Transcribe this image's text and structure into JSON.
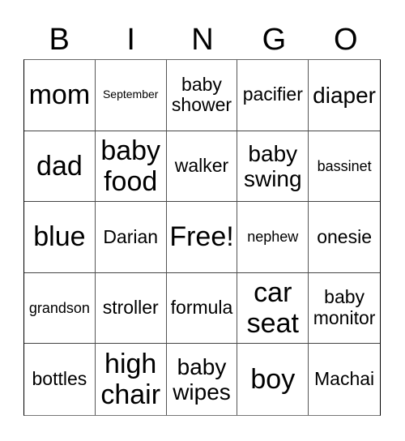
{
  "header": {
    "letters": [
      "B",
      "I",
      "N",
      "G",
      "O"
    ]
  },
  "card": {
    "rows": [
      [
        {
          "text": "mom",
          "size": "xl"
        },
        {
          "text": "September",
          "size": "xs"
        },
        {
          "text": "baby shower",
          "size": "md"
        },
        {
          "text": "pacifier",
          "size": "md"
        },
        {
          "text": "diaper",
          "size": "lg"
        }
      ],
      [
        {
          "text": "dad",
          "size": "xl"
        },
        {
          "text": "baby food",
          "size": "xl"
        },
        {
          "text": "walker",
          "size": "md"
        },
        {
          "text": "baby swing",
          "size": "lg"
        },
        {
          "text": "bassinet",
          "size": "sm"
        }
      ],
      [
        {
          "text": "blue",
          "size": "xl"
        },
        {
          "text": "Darian",
          "size": "md"
        },
        {
          "text": "Free!",
          "size": "xl"
        },
        {
          "text": "nephew",
          "size": "sm"
        },
        {
          "text": "onesie",
          "size": "md"
        }
      ],
      [
        {
          "text": "grandson",
          "size": "sm"
        },
        {
          "text": "stroller",
          "size": "md"
        },
        {
          "text": "formula",
          "size": "md"
        },
        {
          "text": "car seat",
          "size": "xl"
        },
        {
          "text": "baby monitor",
          "size": "md"
        }
      ],
      [
        {
          "text": "bottles",
          "size": "md"
        },
        {
          "text": "high chair",
          "size": "xl"
        },
        {
          "text": "baby wipes",
          "size": "lg"
        },
        {
          "text": "boy",
          "size": "xl"
        },
        {
          "text": "Machai",
          "size": "md"
        }
      ]
    ]
  }
}
